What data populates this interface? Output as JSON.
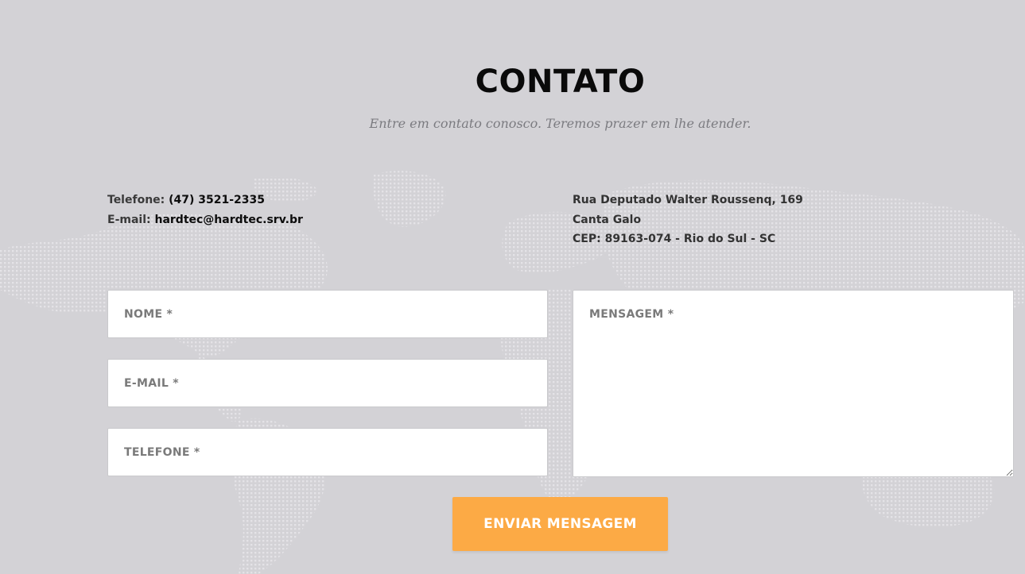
{
  "colors": {
    "background": "#d3d2d6",
    "button": "#fcaa45",
    "button_text": "#ffffff",
    "title": "#0a0a0a",
    "subtitle": "#7b7b80",
    "placeholder": "#7a7a7a"
  },
  "header": {
    "title": "CONTATO",
    "subtitle": "Entre em contato conosco. Teremos prazer em lhe atender."
  },
  "contact": {
    "phone_label": "Telefone:",
    "phone_value": "(47) 3521-2335",
    "email_label": "E-mail:",
    "email_value": "hardtec@hardtec.srv.br"
  },
  "address": {
    "street": "Rua Deputado Walter Roussenq, 169",
    "district": "Canta Galo",
    "cep": "CEP: 89163-074 - Rio do Sul - SC"
  },
  "form": {
    "name_placeholder": "NOME *",
    "email_placeholder": "E-MAIL *",
    "phone_placeholder": "TELEFONE *",
    "message_placeholder": "MENSAGEM *",
    "submit_label": "ENVIAR MENSAGEM"
  },
  "background_image": "world-map-dots"
}
